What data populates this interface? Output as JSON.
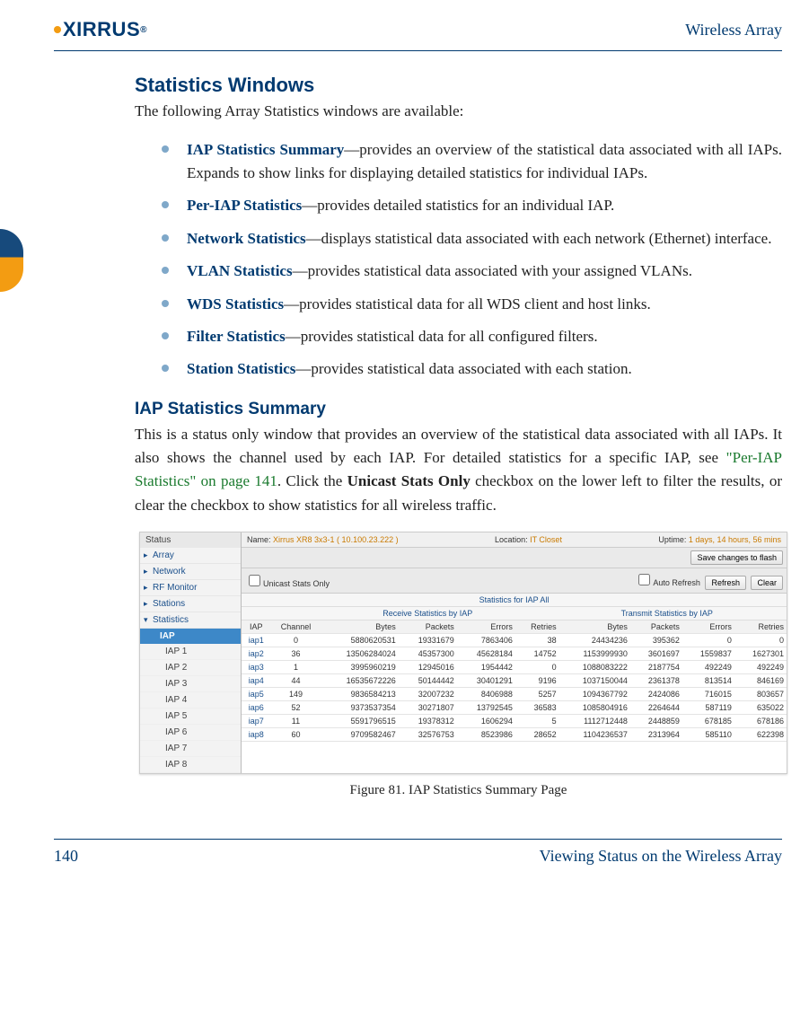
{
  "header": {
    "brand": "XIRRUS",
    "right": "Wireless Array"
  },
  "section_title": "Statistics Windows",
  "section_intro": "The following Array Statistics windows are available:",
  "bullets": [
    {
      "term": "IAP Statistics Summary",
      "desc": "—provides an overview of the statistical data associated with all IAPs. Expands to show links for displaying detailed statistics for individual IAPs."
    },
    {
      "term": "Per-IAP Statistics",
      "desc": "—provides detailed statistics for an individual IAP."
    },
    {
      "term": "Network Statistics",
      "desc": "—displays statistical data associated with each network (Ethernet) interface."
    },
    {
      "term": "VLAN Statistics",
      "desc": "—provides statistical data associated with your assigned VLANs."
    },
    {
      "term": "WDS Statistics",
      "desc": "—provides statistical data for all WDS client and host links."
    },
    {
      "term": "Filter Statistics",
      "desc": "—provides statistical data for all configured filters."
    },
    {
      "term": "Station Statistics",
      "desc": "—provides statistical data associated with each station."
    }
  ],
  "subsection_title": "IAP Statistics Summary",
  "subsection_body_a": "This is a status only window that provides an overview of the statistical data associated with all IAPs. It also shows the channel used by each IAP. For detailed statistics for a specific IAP, see ",
  "subsection_link": "\"Per-IAP Statistics\" on page 141",
  "subsection_body_b": ". Click the ",
  "subsection_bold": "Unicast Stats Only",
  "subsection_body_c": " checkbox on the lower left to filter the results, or clear the checkbox to show statistics for all wireless traffic.",
  "shot": {
    "sidebar_header": "Status",
    "sidebar_nav": [
      "Array",
      "Network",
      "RF Monitor",
      "Stations",
      "Statistics"
    ],
    "sidebar_selected": "IAP",
    "sidebar_sub": [
      "IAP 1",
      "IAP 2",
      "IAP 3",
      "IAP 4",
      "IAP 5",
      "IAP 6",
      "IAP 7",
      "IAP 8"
    ],
    "name_label": "Name:",
    "name_value": "Xirrus XR8 3x3-1  ( 10.100.23.222 )",
    "location_label": "Location:",
    "location_value": "IT Closet",
    "uptime_label": "Uptime:",
    "uptime_value": "1 days, 14 hours, 56 mins",
    "save_btn": "Save changes to flash",
    "unicast_label": "Unicast Stats Only",
    "autorefresh_label": "Auto Refresh",
    "refresh_btn": "Refresh",
    "clear_btn": "Clear",
    "stats_title": "Statistics for IAP All",
    "rx_title": "Receive Statistics by IAP",
    "tx_title": "Transmit Statistics by IAP",
    "cols": [
      "IAP",
      "Channel",
      "Bytes",
      "Packets",
      "Errors",
      "Retries",
      "Bytes",
      "Packets",
      "Errors",
      "Retries"
    ]
  },
  "chart_data": {
    "type": "table",
    "columns": [
      "IAP",
      "Channel",
      "RX Bytes",
      "RX Packets",
      "RX Errors",
      "RX Retries",
      "TX Bytes",
      "TX Packets",
      "TX Errors",
      "TX Retries"
    ],
    "rows": [
      [
        "iap1",
        0,
        5880620531,
        19331679,
        7863406,
        38,
        24434236,
        395362,
        0,
        0
      ],
      [
        "iap2",
        36,
        13506284024,
        45357300,
        45628184,
        14752,
        1153999930,
        3601697,
        1559837,
        1627301
      ],
      [
        "iap3",
        1,
        3995960219,
        12945016,
        1954442,
        0,
        1088083222,
        2187754,
        492249,
        492249
      ],
      [
        "iap4",
        44,
        16535672226,
        50144442,
        30401291,
        9196,
        1037150044,
        2361378,
        813514,
        846169
      ],
      [
        "iap5",
        149,
        9836584213,
        32007232,
        8406988,
        5257,
        1094367792,
        2424086,
        716015,
        803657
      ],
      [
        "iap6",
        52,
        9373537354,
        30271807,
        13792545,
        36583,
        1085804916,
        2264644,
        587119,
        635022
      ],
      [
        "iap7",
        11,
        5591796515,
        19378312,
        1606294,
        5,
        1112712448,
        2448859,
        678185,
        678186
      ],
      [
        "iap8",
        60,
        9709582467,
        32576753,
        8523986,
        28652,
        1104236537,
        2313964,
        585110,
        622398
      ]
    ]
  },
  "figure_caption": "Figure 81. IAP Statistics Summary Page",
  "footer": {
    "page_number": "140",
    "chapter": "Viewing Status on the Wireless Array"
  }
}
